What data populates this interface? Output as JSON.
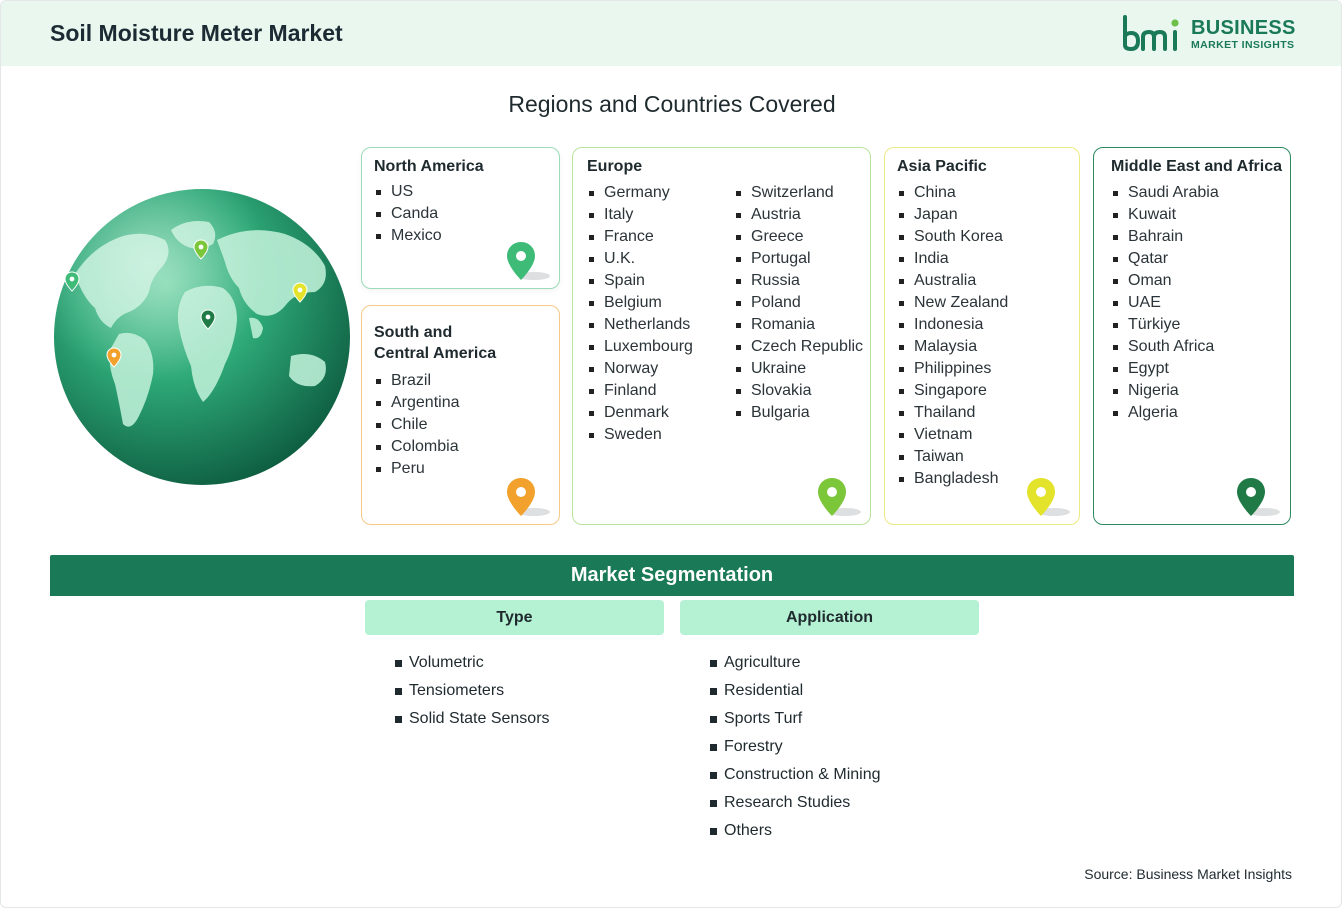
{
  "header": {
    "title": "Soil Moisture Meter Market"
  },
  "logo": {
    "mark": "bmi",
    "line1": "BUSINESS",
    "line2": "MARKET INSIGHTS"
  },
  "section_title": "Regions and Countries Covered",
  "regions": {
    "north_america": {
      "title": "North America",
      "items": [
        "US",
        "Canda",
        "Mexico"
      ],
      "pin_color": "#3dbb77"
    },
    "south_central_america": {
      "title_line1": "South and",
      "title_line2": "Central America",
      "items": [
        "Brazil",
        "Argentina",
        "Chile",
        "Colombia",
        "Peru"
      ],
      "pin_color": "#f2a12c"
    },
    "europe": {
      "title": "Europe",
      "col1": [
        "Germany",
        "Italy",
        "France",
        "U.K.",
        "Spain",
        "Belgium",
        "Netherlands",
        "Luxembourg",
        "Norway",
        "Finland",
        "Denmark",
        "Sweden"
      ],
      "col2": [
        "Switzerland",
        "Austria",
        "Greece",
        "Portugal",
        "Russia",
        "Poland",
        "Romania",
        "Czech Republic",
        "Ukraine",
        "Slovakia",
        "Bulgaria"
      ],
      "pin_color": "#7cc63a"
    },
    "asia_pacific": {
      "title": "Asia Pacific",
      "items": [
        "China",
        "Japan",
        "South Korea",
        "India",
        "Australia",
        "New Zealand",
        "Indonesia",
        "Malaysia",
        "Philippines",
        "Singapore",
        "Thailand",
        "Vietnam",
        "Taiwan",
        "Bangladesh"
      ],
      "pin_color": "#e3e32c"
    },
    "middle_east_africa": {
      "title": "Middle East and Africa",
      "items": [
        "Saudi Arabia",
        "Kuwait",
        "Bahrain",
        "Qatar",
        "Oman",
        "UAE",
        "Türkiye",
        "South Africa",
        "Egypt",
        "Nigeria",
        "Algeria"
      ],
      "pin_color": "#1f7a45"
    }
  },
  "segmentation": {
    "title": "Market Segmentation",
    "type": {
      "heading": "Type",
      "items": [
        "Volumetric",
        "Tensiometers",
        "Solid State Sensors"
      ]
    },
    "application": {
      "heading": "Application",
      "items": [
        "Agriculture",
        "Residential",
        "Sports Turf",
        "Forestry",
        "Construction & Mining",
        "Research Studies",
        "Others"
      ]
    }
  },
  "source": "Source: Business Market Insights",
  "colors": {
    "brand_green": "#1a7a57",
    "header_bg": "#e9f7ef",
    "segment_head_bg": "#b5f2d4"
  }
}
